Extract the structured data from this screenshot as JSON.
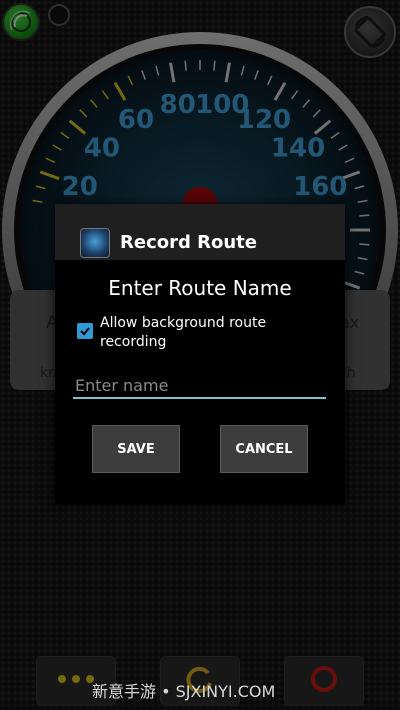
{
  "gauge": {
    "speed_ticks": [
      "20",
      "40",
      "60",
      "80",
      "100",
      "120",
      "140",
      "160"
    ],
    "left_panel_fragments": [
      "A",
      "km"
    ],
    "right_panel_fragments": [
      "ax",
      "/h"
    ]
  },
  "dialog": {
    "title": "Record Route",
    "heading": "Enter Route Name",
    "checkbox_label": "Allow background route recording",
    "checkbox_checked": true,
    "input_placeholder": "Enter name",
    "input_value": "",
    "save_label": "SAVE",
    "cancel_label": "CANCEL"
  },
  "colors": {
    "accent": "#2e9bd6",
    "input_underline": "#7dc4c6",
    "gauge_digits": "#3ea0d6",
    "gps_green": "#2db52d"
  },
  "bottom_bar": {
    "menu_icon": "more-dots-icon",
    "middle_icon": "refresh-ring-icon",
    "right_icon": "record-ring-icon"
  },
  "watermark": "新意手游 • SJXINYI.COM"
}
